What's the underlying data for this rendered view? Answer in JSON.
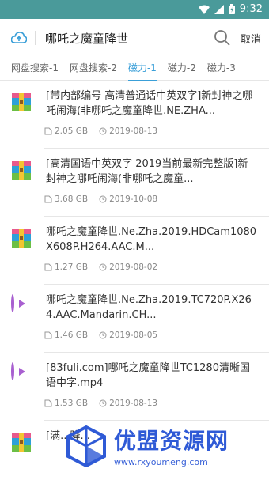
{
  "status": {
    "time": "9:32"
  },
  "search": {
    "query": "哪吒之魔童降世",
    "cancel_label": "取消"
  },
  "tabs": [
    {
      "label": "网盘搜索-1",
      "active": false
    },
    {
      "label": "网盘搜索-2",
      "active": false
    },
    {
      "label": "磁力-1",
      "active": true
    },
    {
      "label": "磁力-2",
      "active": false
    },
    {
      "label": "磁力-3",
      "active": false
    }
  ],
  "results": [
    {
      "icon": "archive-icon",
      "title": "[带内部编号 高清普通话中英双字]新封神之哪吒闹海(非哪吒之魔童降世.NE.ZHA...",
      "size": "2.05 GB",
      "date": "2019-08-13"
    },
    {
      "icon": "archive-icon",
      "title": "[高清国语中英双字 2019当前最新完整版]新封神之哪吒闹海(非哪吒之魔童...",
      "size": "3.68 GB",
      "date": "2019-10-08"
    },
    {
      "icon": "archive-icon",
      "title": "哪吒之魔童降世.Ne.Zha.2019.HDCam1080X608P.H264.AAC.M...",
      "size": "1.27 GB",
      "date": "2019-08-02"
    },
    {
      "icon": "video-play-icon",
      "title": "哪吒之魔童降世.Ne.Zha.2019.TC720P.X264.AAC.Mandarin.CH...",
      "size": "1.46 GB",
      "date": "2019-08-05"
    },
    {
      "icon": "video-play-icon",
      "title": "[83fuli.com]哪吒之魔童降世TC1280清晰国语中字.mp4",
      "size": "1.53 GB",
      "date": "2019-08-13"
    },
    {
      "icon": "archive-icon",
      "title": "[满...降...",
      "size": "",
      "date": ""
    }
  ],
  "watermark": {
    "title": "优盟资源网",
    "url": "www.rxyoumeng.com"
  },
  "colors": {
    "status_bar": "#4a9a9a",
    "accent": "#3a9fd8",
    "video": "#a85fd0",
    "watermark": "#2f5ad6"
  }
}
